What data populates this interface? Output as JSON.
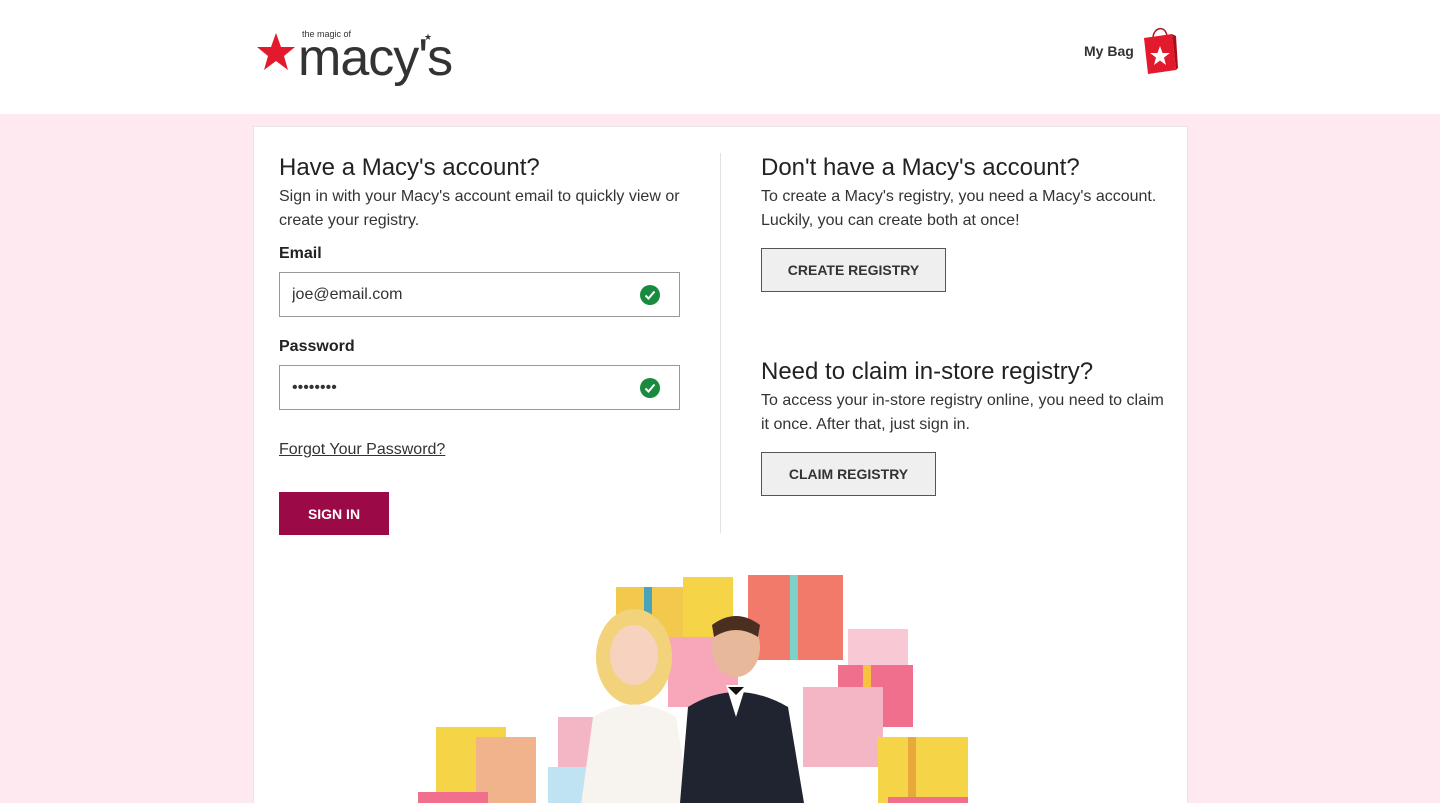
{
  "header": {
    "logo": {
      "tagline": "the magic of",
      "wordmark": "macy's"
    },
    "bag_label": "My Bag"
  },
  "signin": {
    "heading": "Have a Macy's account?",
    "description": "Sign in with your Macy's account email to quickly view or create your registry.",
    "email_label": "Email",
    "email_value": "joe@email.com",
    "password_label": "Password",
    "password_value": "••••••••",
    "forgot_link": "Forgot Your Password?",
    "signin_button": "SIGN IN"
  },
  "create": {
    "heading": "Don't have a Macy's account?",
    "description": "To create a Macy's registry, you need a Macy's account. Luckily, you can create both at once!",
    "button": "CREATE REGISTRY"
  },
  "claim": {
    "heading": "Need to claim in-store registry?",
    "description": "To access your in-store registry online, you need to claim it once. After that, just sign in.",
    "button": "CLAIM REGISTRY"
  },
  "colors": {
    "brand_red": "#e21a2c",
    "signin_button": "#9b0a47",
    "page_background": "#fde9ef",
    "valid_check": "#1a8a3f"
  },
  "icons": [
    "macys-star-icon",
    "shopping-bag-icon",
    "check-circle-icon"
  ]
}
